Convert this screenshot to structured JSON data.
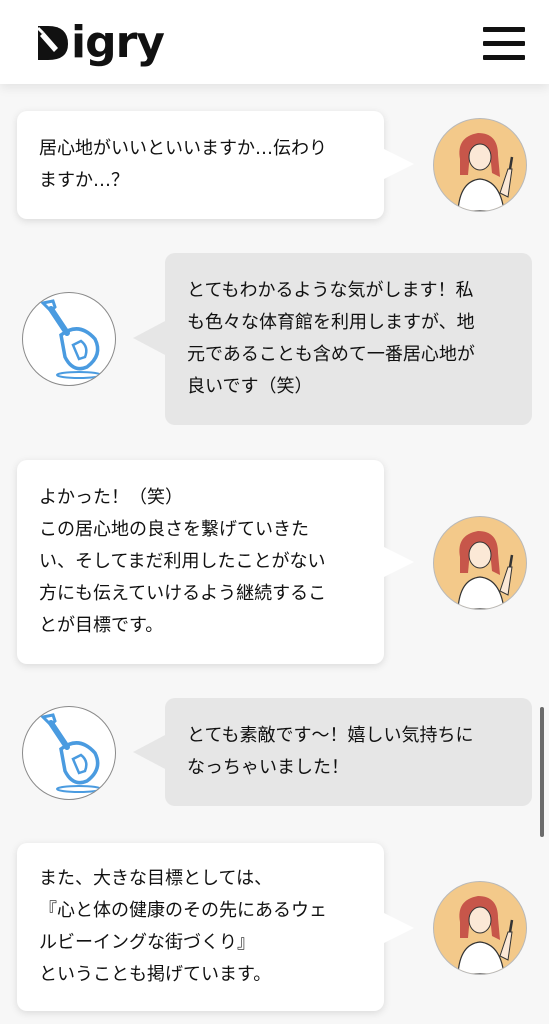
{
  "header": {
    "logo_text": "igry",
    "logo_icon": "shovel-d-logo",
    "menu_icon": "hamburger-menu-icon"
  },
  "messages": [
    {
      "speaker": "interviewee",
      "avatar": "woman-pointing-avatar",
      "text": "居心地がいいといいますか…伝わり\nますか…？"
    },
    {
      "speaker": "interviewer",
      "avatar": "shovel-avatar",
      "text": "とてもわかるような気がします！私\nも色々な体育館を利用しますが、地\n元であることも含めて一番居心地が\n良いです（笑）"
    },
    {
      "speaker": "interviewee",
      "avatar": "woman-pointing-avatar",
      "text": "よかった！（笑）\nこの居心地の良さを繋げていきた\nい、そしてまだ利用したことがない\n方にも伝えていけるよう継続するこ\nとが目標です。"
    },
    {
      "speaker": "interviewer",
      "avatar": "shovel-avatar",
      "text": "とても素敵です〜！嬉しい気持ちに\nなっちゃいました！"
    },
    {
      "speaker": "interviewee",
      "avatar": "woman-pointing-avatar",
      "text": "また、大きな目標としては、\n『心と体の健康のその先にあるウェ\nルビーイングな街づくり』\nということも掲げています。"
    }
  ],
  "colors": {
    "avatar_bg": "#f3c98a",
    "shovel_blue": "#4a9be0",
    "bubble_gray": "#e6e6e6"
  }
}
